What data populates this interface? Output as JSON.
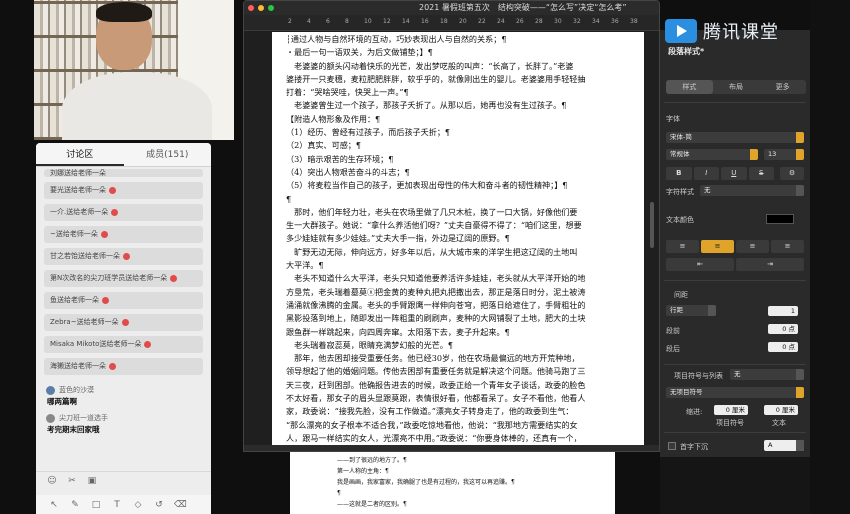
{
  "chat": {
    "tab_chat": "讨论区",
    "tab_members": "成员(151)",
    "gifts": [
      "刘娜送给老师一朵",
      "要光送给老师一朵",
      "一介.送给老师一朵",
      "~送给老师一朵",
      "甘之若饴送给老师一朵",
      "第N次改名的尖刀班学员送给老师一朵",
      "鱼送给老师一朵",
      "Zebra~送给老师一朵",
      "Misaka Mikoto送给老师一朵",
      "海獭送给老师一朵"
    ],
    "messages": [
      {
        "user": "蓝色的沙漠",
        "text": "哪两篇啊"
      },
      {
        "user": "尖刀班一道选手",
        "text": "考完期末回家哦"
      }
    ]
  },
  "editor": {
    "title": "2021 暑假班第五次　结构突破——“怎么写”决定“怎么考”",
    "ruler_marks": [
      "2",
      "4",
      "6",
      "8",
      "10",
      "12",
      "14",
      "16",
      "18",
      "20",
      "22",
      "24",
      "26",
      "28",
      "30",
      "32",
      "34",
      "36",
      "38"
    ],
    "page_lines": [
      "┆通过人物与自然环境的互动，巧妙表现出人与自然的关系；¶",
      "・最后一句一语双关，为后文做铺垫；】¶",
      "　老婆婆的额头闪动着快乐的光芒，发出梦呓般的叫声：“长高了，长胖了。”老婆",
      "婆搂开一只麦穗，麦粒肥肥胖胖，软乎乎的，就像刚出生的婴儿。老婆婆用手轻轻抽",
      "打着：“哭啥哭哇，快哭上一声。”¶",
      "　老婆婆曾生过一个孩子，那孩子夭折了。从那以后，她再也没有生过孩子。¶",
      "【附造人物形象及作用：¶",
      "（1）经历、曾经有过孩子，而后孩子夭折；¶",
      "（2）真实、可感；¶",
      "（3）暗示艰苦的生存环境；¶",
      "（4）突出人物艰苦奋斗的斗志；¶",
      "（5）将麦粒当作自己的孩子，更加表现出母性的伟大和奋斗者的韧性精神；】¶",
      "¶",
      "　那时，他们年轻力壮，老头在农场里做了几只木桩，换了一口大锅，好像他们要",
      "生一大群孩子。她说：“拿什么养活他们呀？”丈夫自豪得不得了：“咱们这里，想要",
      "多少娃娃就有多少娃娃。”丈夫大手一指，外边是辽阔的原野。¶",
      "　旷野无边无际，伸向远方，好多年以后，从大城市来的洋学生把这辽阔的土地叫",
      "大平洋。¶",
      "　老头不知道什么大平洋，老头只知道他要养活许多娃娃，老头就从大平洋开始的地",
      "方垦荒，老头瑞着墓莫ⓧ把金黄的麦种丸把丸把撒出去，那正是落日时分，泥土被涛",
      "涌涌就像沸腾的金属。老头的手臂跟鹰一样伸向苍穹，把落日给遮住了，手臂粗壮的",
      "黑影投落到地上，随即发出一阵粗重的刷刷声，麦种的大网铺裂了土地，肥大的土块",
      "跟鱼群一样跳起来，向四周奔窜。太阳落下去，麦子升起来。¶",
      "　老头瑞着寂蕊莫，眼睛充满梦幻般的光芒。¶",
      "　那年，他去困却接受重要任务。他已经30岁，他在农场最偏远的地方开荒种地，",
      "领导想起了他的婚姻问题。传他去困部有重要任务就是解决这个问题。他骑马跑了三",
      "天三夜，赶到困部。他确报告进去的时候，政委正给一个青年女子谈话，政委的脸色",
      "不太好看，那女子的眉头显跟莫跟，表情很好看，他都看呆了。女子不看他，他看人",
      "家，政委说：“接我先脸，没有工作做道。”漂亮女子转身走了，他的政委到生气：",
      "“那么漂亮的女子根本不适合我，”政委吃惊地看他，他说：“我那地方需要结实的女",
      "人，跟马一样结实的女人，光漂亮不中用。”政委说：“你要身体棒的，还真有一个，",
      "长相差些，心灵绝对美。”¶",
      "　他骑该就见到那个大块头女人，他口在做漏见面的，她是放草料头，番茄腌里"
    ],
    "page2_lines": [
      "——到了很远的地方了。¶",
      "第一人称的主角：¶",
      "我是画画，我家富家，我确腿了也是有过程的，我这可以再追赚。¶",
      "¶",
      "——这就是二者的区别。¶"
    ]
  },
  "inspector": {
    "logo_text": "腾讯课堂",
    "header": "段落样式*",
    "seg_tabs": [
      "样式",
      "布局",
      "更多"
    ],
    "font_label": "字体",
    "font_name": "宋体-简",
    "font_weight": "常规体",
    "font_size": "13",
    "bold": "B",
    "italic": "I",
    "underline": "U",
    "strike": "S",
    "char_style_label": "字符样式",
    "char_style_value": "无",
    "text_color_label": "文本颜色",
    "spacing_label": "间距",
    "spacing_value": "行距",
    "spacing_num": "1",
    "before_label": "段前",
    "before_num": "0 点",
    "after_label": "段后",
    "after_num": "0 点",
    "bullets_label": "项目符号与列表",
    "bullets_value": "无",
    "bullet_symbol": "无项目符号",
    "indent_label": "缩进:",
    "indent_bullet": "0 厘米",
    "indent_text": "0 厘米",
    "indent_sub1": "项目符号",
    "indent_sub2": "文本",
    "dropcap_label": "首字下沉"
  },
  "colors": {
    "accent": "#e0a42a",
    "paragraph_mark": "#2a6bd1",
    "logo_blue": "#2a8fe0",
    "gift_dot": "#e24b4b"
  }
}
